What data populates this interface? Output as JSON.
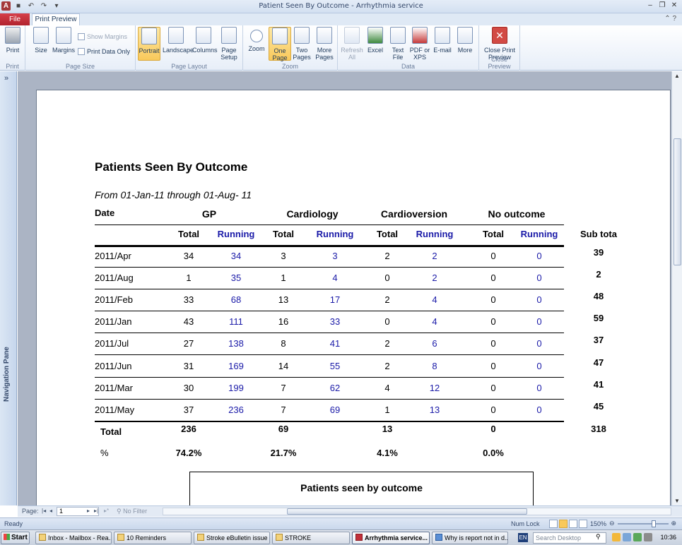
{
  "window": {
    "title": "Patient Seen By Outcome  -  Arrhythmia service",
    "app_icon": "A"
  },
  "ribbon": {
    "file_tab": "File",
    "active_tab": "Print Preview",
    "groups": [
      {
        "label": "Print"
      },
      {
        "label": "Page Size"
      },
      {
        "label": "Page Layout"
      },
      {
        "label": "Zoom"
      },
      {
        "label": "Data"
      },
      {
        "label": "Close Preview"
      }
    ],
    "buttons": {
      "print": "Print",
      "size": "Size",
      "margins": "Margins",
      "show_margins": "Show Margins",
      "print_data_only": "Print Data Only",
      "portrait": "Portrait",
      "landscape": "Landscape",
      "columns": "Columns",
      "page_setup": "Page Setup",
      "zoom": "Zoom",
      "one_page": "One Page",
      "two_pages": "Two Pages",
      "more_pages": "More Pages",
      "refresh_all": "Refresh All",
      "excel": "Excel",
      "text_file": "Text File",
      "pdf_xps": "PDF or XPS",
      "email": "E-mail",
      "more": "More",
      "close_print_preview": "Close Print Preview"
    }
  },
  "nav_pane": {
    "label": "Navigation Pane",
    "toggle": "»"
  },
  "report": {
    "title": "Patients Seen By Outcome",
    "range": "From 01-Jan-11 through 01-Aug- 11",
    "date_header": "Date",
    "groups": [
      "GP",
      "Cardiology",
      "Cardioversion",
      "No outcome"
    ],
    "sub_total_label": "Total",
    "sub_running_label": "Running",
    "subtotal_header": "Sub tota",
    "rows": [
      {
        "date": "2011/Apr",
        "vals": [
          "34",
          "34",
          "3",
          "3",
          "2",
          "2",
          "0",
          "0"
        ],
        "sub": "39"
      },
      {
        "date": "2011/Aug",
        "vals": [
          "1",
          "35",
          "1",
          "4",
          "0",
          "2",
          "0",
          "0"
        ],
        "sub": "2"
      },
      {
        "date": "2011/Feb",
        "vals": [
          "33",
          "68",
          "13",
          "17",
          "2",
          "4",
          "0",
          "0"
        ],
        "sub": "48"
      },
      {
        "date": "2011/Jan",
        "vals": [
          "43",
          "111",
          "16",
          "33",
          "0",
          "4",
          "0",
          "0"
        ],
        "sub": "59"
      },
      {
        "date": "2011/Jul",
        "vals": [
          "27",
          "138",
          "8",
          "41",
          "2",
          "6",
          "0",
          "0"
        ],
        "sub": "37"
      },
      {
        "date": "2011/Jun",
        "vals": [
          "31",
          "169",
          "14",
          "55",
          "2",
          "8",
          "0",
          "0"
        ],
        "sub": "47"
      },
      {
        "date": "2011/Mar",
        "vals": [
          "30",
          "199",
          "7",
          "62",
          "4",
          "12",
          "0",
          "0"
        ],
        "sub": "41"
      },
      {
        "date": "2011/May",
        "vals": [
          "37",
          "236",
          "7",
          "69",
          "1",
          "13",
          "0",
          "0"
        ],
        "sub": "45"
      }
    ],
    "total_label": "Total",
    "totals": [
      "236",
      "69",
      "13",
      "0"
    ],
    "grand_total": "318",
    "pct_label": "%",
    "pcts": [
      "74.2%",
      "21.7%",
      "4.1%",
      "0.0%"
    ],
    "chart_title": "Patients seen by outcome"
  },
  "pagebar": {
    "label": "Page:",
    "page_value": "1",
    "filter": "No Filter"
  },
  "status": {
    "ready": "Ready",
    "num_lock": "Num Lock",
    "zoom": "150%"
  },
  "taskbar": {
    "start": "Start",
    "tasks": [
      "Inbox - Mailbox - Rea...",
      "10 Reminders",
      "Stroke eBulletin issue ...",
      "STROKE",
      "Arrhythmia service...",
      "Why is report not in d..."
    ],
    "search_placeholder": "Search Desktop",
    "lang": "EN",
    "clock": "10:36"
  },
  "colors": {
    "running_blue": "#1a1aa8",
    "file_tab_red": "#c1303a",
    "active_button": "#f9c95b"
  }
}
